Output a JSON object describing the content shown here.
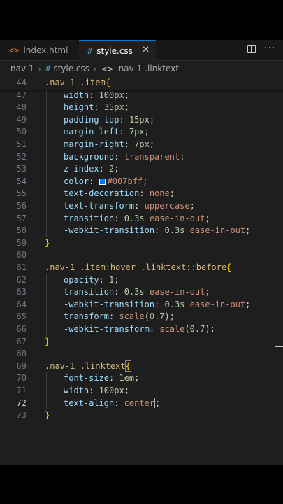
{
  "tabs": [
    {
      "icon": "<>",
      "label": "index.html"
    },
    {
      "icon": "#",
      "label": "style.css",
      "close": "✕"
    }
  ],
  "breadcrumb": [
    "nav-1",
    "style.css",
    ".nav-1 .linktext"
  ],
  "colors": {
    "swatch": "#007bff",
    "accent": "#0078d4"
  },
  "code": {
    "active_line": "72",
    "lines": [
      {
        "n": "44",
        "text": ".nav-1 .item{"
      },
      {
        "n": "47",
        "text": "width: 100px;"
      },
      {
        "n": "48",
        "text": "height: 35px;"
      },
      {
        "n": "49",
        "text": "padding-top: 15px;"
      },
      {
        "n": "50",
        "text": "margin-left: 7px;"
      },
      {
        "n": "51",
        "text": "margin-right: 7px;"
      },
      {
        "n": "52",
        "text": "background: transparent;"
      },
      {
        "n": "53",
        "text": "z-index: 2;"
      },
      {
        "n": "54",
        "text": "color: #007bff;"
      },
      {
        "n": "55",
        "text": "text-decoration: none;"
      },
      {
        "n": "56",
        "text": "text-transform: uppercase;"
      },
      {
        "n": "57",
        "text": "transition: 0.3s ease-in-out;"
      },
      {
        "n": "58",
        "text": "-webkit-transition: 0.3s ease-in-out;"
      },
      {
        "n": "59",
        "text": "}"
      },
      {
        "n": "60",
        "text": ""
      },
      {
        "n": "61",
        "text": ".nav-1 .item:hover .linktext::before{"
      },
      {
        "n": "62",
        "text": "opacity: 1;"
      },
      {
        "n": "63",
        "text": "transition: 0.3s ease-in-out;"
      },
      {
        "n": "64",
        "text": "-webkit-transition: 0.3s ease-in-out;"
      },
      {
        "n": "65",
        "text": "transform: scale(0.7);"
      },
      {
        "n": "66",
        "text": "-webkit-transform: scale(0.7);"
      },
      {
        "n": "67",
        "text": "}"
      },
      {
        "n": "68",
        "text": ""
      },
      {
        "n": "69",
        "text": ".nav-1 .linktext{"
      },
      {
        "n": "70",
        "text": "font-size: 1em;"
      },
      {
        "n": "71",
        "text": "width: 100px;"
      },
      {
        "n": "72",
        "text": "text-align: center;"
      },
      {
        "n": "73",
        "text": "}"
      }
    ]
  }
}
